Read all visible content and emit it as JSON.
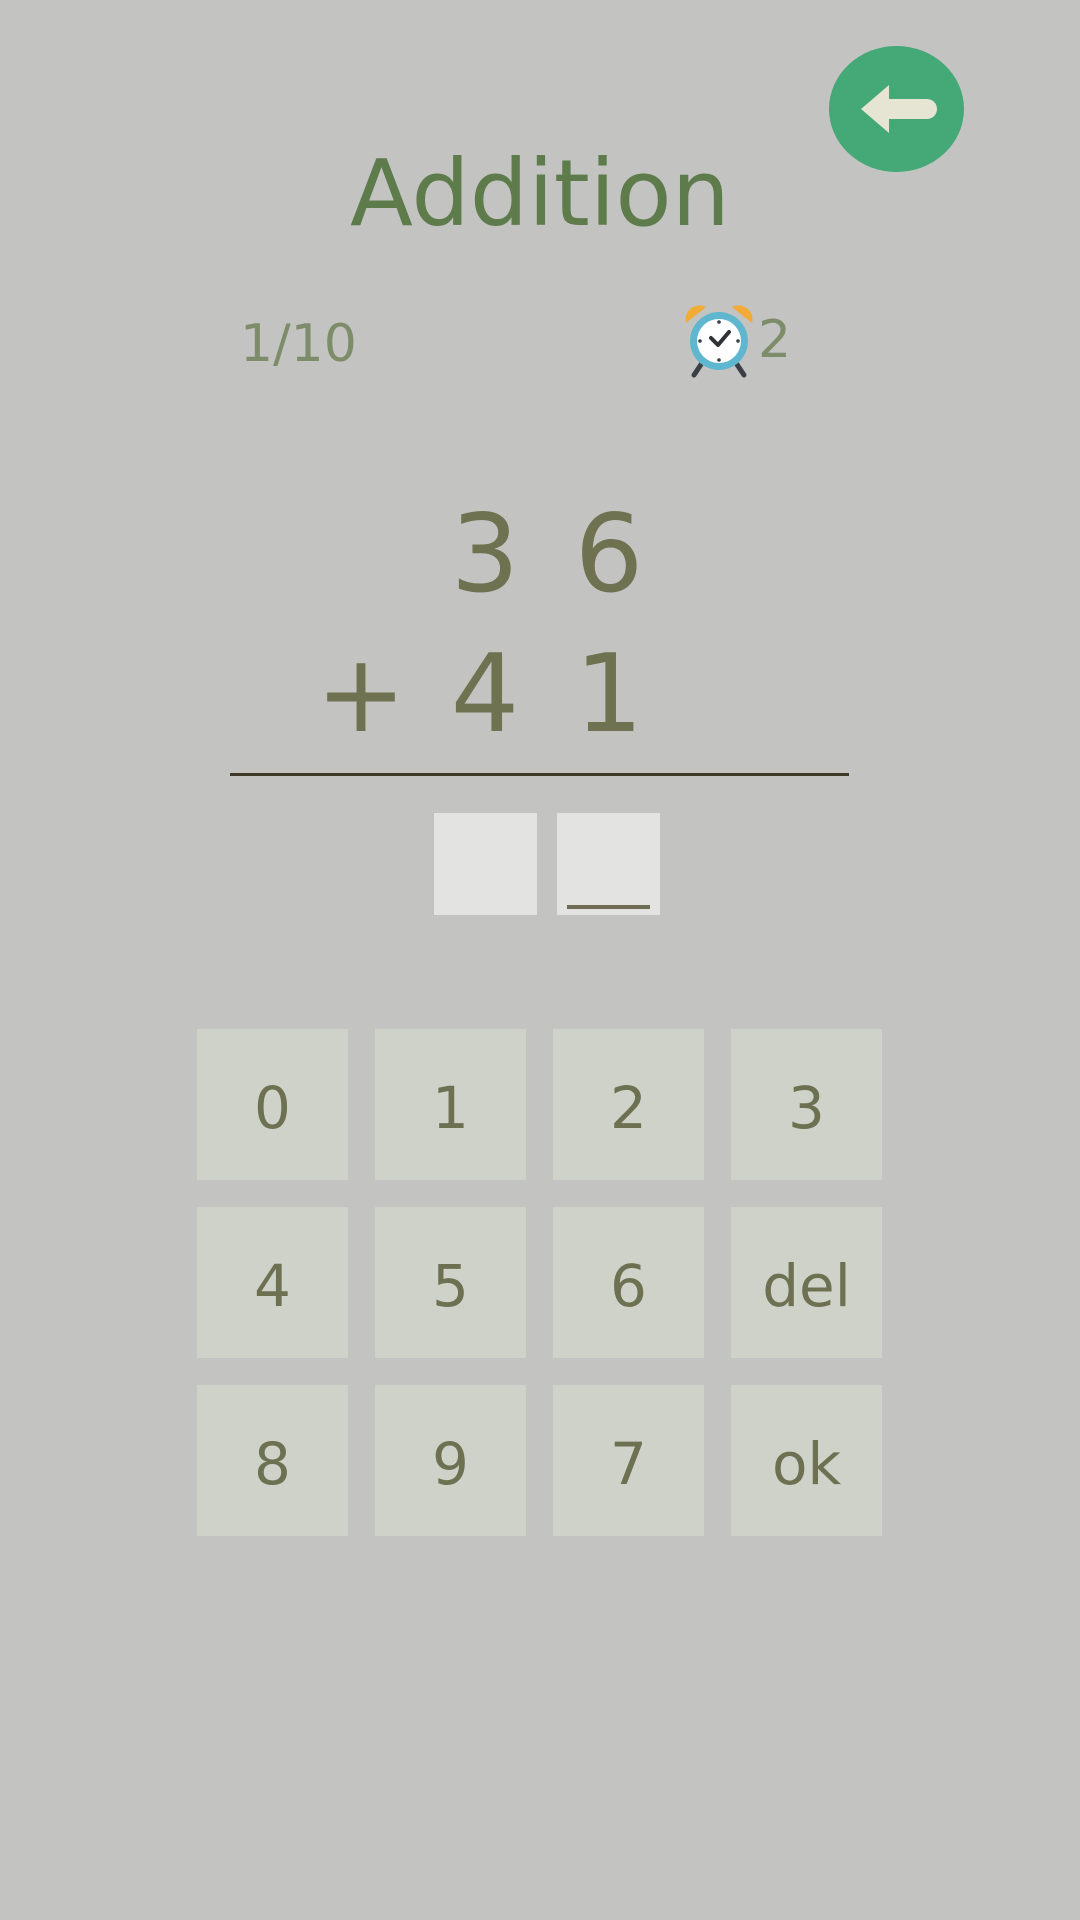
{
  "header": {
    "title": "Addition",
    "back_icon": "arrow-left-icon"
  },
  "status": {
    "progress": "1/10",
    "timer_icon": "alarm-clock-icon",
    "timer_value": "2"
  },
  "problem": {
    "top_tens": "3",
    "top_ones": "6",
    "operator": "+",
    "bottom_tens": "4",
    "bottom_ones": "1"
  },
  "answer": {
    "tens": "",
    "ones": ""
  },
  "keypad": {
    "keys": [
      "0",
      "1",
      "2",
      "3",
      "4",
      "5",
      "6",
      "del",
      "8",
      "9",
      "7",
      "ok"
    ]
  },
  "colors": {
    "background": "#c3c3c2",
    "accent": "#44a877",
    "title": "#5e7c4b",
    "digits": "#6f7250",
    "key_bg": "#cfd2c9",
    "answer_bg": "#e3e4e1"
  }
}
